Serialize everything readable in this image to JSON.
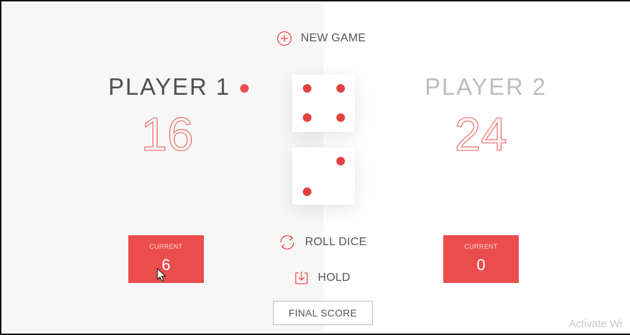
{
  "controls": {
    "new_game": "NEW GAME",
    "roll_dice": "ROLL DICE",
    "hold": "HOLD"
  },
  "players": [
    {
      "name": "PLAYER 1",
      "score": "16",
      "current_label": "CURRENT",
      "current": "6",
      "active": true
    },
    {
      "name": "PLAYER 2",
      "score": "24",
      "current_label": "CURRENT",
      "current": "0",
      "active": false
    }
  ],
  "dice": [
    4,
    2
  ],
  "final_score": {
    "placeholder": "FINAL SCORE"
  },
  "watermark": "Activate Wi",
  "colors": {
    "accent": "#eb4d4d",
    "left_panel": "#f7f7f7",
    "right_panel": "#ffffff"
  },
  "icons": {
    "new_game": "plus-circle-icon",
    "roll_dice": "refresh-icon",
    "hold": "download-icon",
    "cursor": "mouse-pointer-icon"
  }
}
